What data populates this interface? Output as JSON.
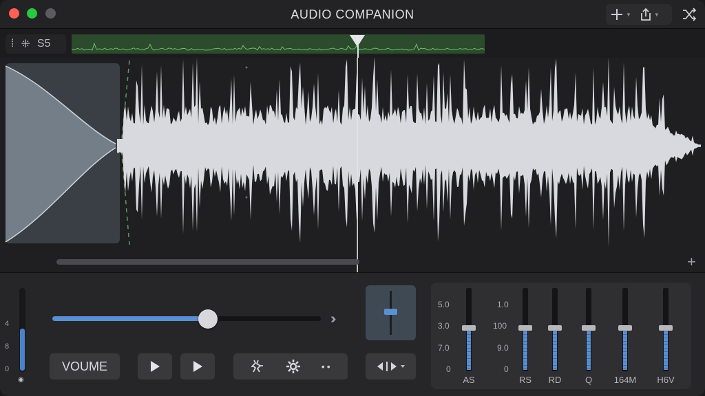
{
  "window": {
    "title": "AUDIO COMPANION"
  },
  "toolbar": {
    "add_icon": "plus-icon",
    "share_icon": "share-icon",
    "shuffle_icon": "shuffle-icon"
  },
  "ruler": {
    "tool_labels": [
      "⁞",
      "⁜",
      "S5"
    ]
  },
  "transport": {
    "playhead_fraction": 0.507,
    "volume_fraction": 0.58,
    "volume_label": "VOUME",
    "meter_scale": [
      "4",
      "8",
      "0"
    ],
    "meter_level": 0.52,
    "fader_level": 0.53
  },
  "mixer": {
    "labels": [
      "5.0",
      "3.0",
      "7.0",
      "0",
      "1.0",
      "100",
      "9.0",
      "0"
    ],
    "channels": [
      {
        "name": "AS",
        "level": 0.52
      },
      {
        "name": "RS",
        "level": 0.52
      },
      {
        "name": "RD",
        "level": 0.52
      },
      {
        "name": "Q",
        "level": 0.52
      },
      {
        "name": "164M",
        "level": 0.52
      },
      {
        "name": "H6V",
        "level": 0.52
      }
    ]
  },
  "colors": {
    "accent": "#5b8fd1",
    "overview_green": "#2c4a2c",
    "waveform": "#d7d9de",
    "selection": "#3a3f45"
  }
}
